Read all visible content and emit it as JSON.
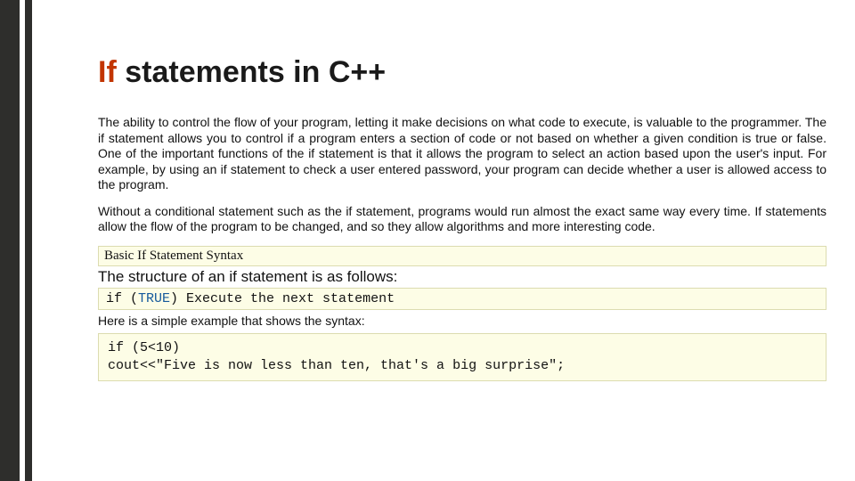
{
  "title": {
    "highlight": "If",
    "rest": " statements in C++"
  },
  "paragraphs": {
    "p1": "The ability to control the flow of your program, letting it make decisions on what code to execute, is valuable to the programmer. The if statement allows you to control if a program enters a section of code or not based on whether a given condition is true or false. One of the important functions of the if statement is that it allows the program to select an action based upon the user's input. For example, by using an if statement to check a user entered password, your program can decide whether a user is allowed access to the program.",
    "p2": "Without a conditional statement such as the if statement, programs would run almost the exact same way every time. If statements allow the flow of the program to be changed, and so they allow algorithms and more interesting code."
  },
  "syntax_label": "Basic If Statement Syntax",
  "structure_text": "The structure of an if statement is as follows:",
  "code_line": {
    "pre": "if (",
    "kw": "TRUE",
    "post": ") Execute the next statement"
  },
  "example_lead": "Here is a simple example that shows the syntax:",
  "code_box": "if (5<10)\ncout<<\"Five is now less than ten, that's a big surprise\";"
}
